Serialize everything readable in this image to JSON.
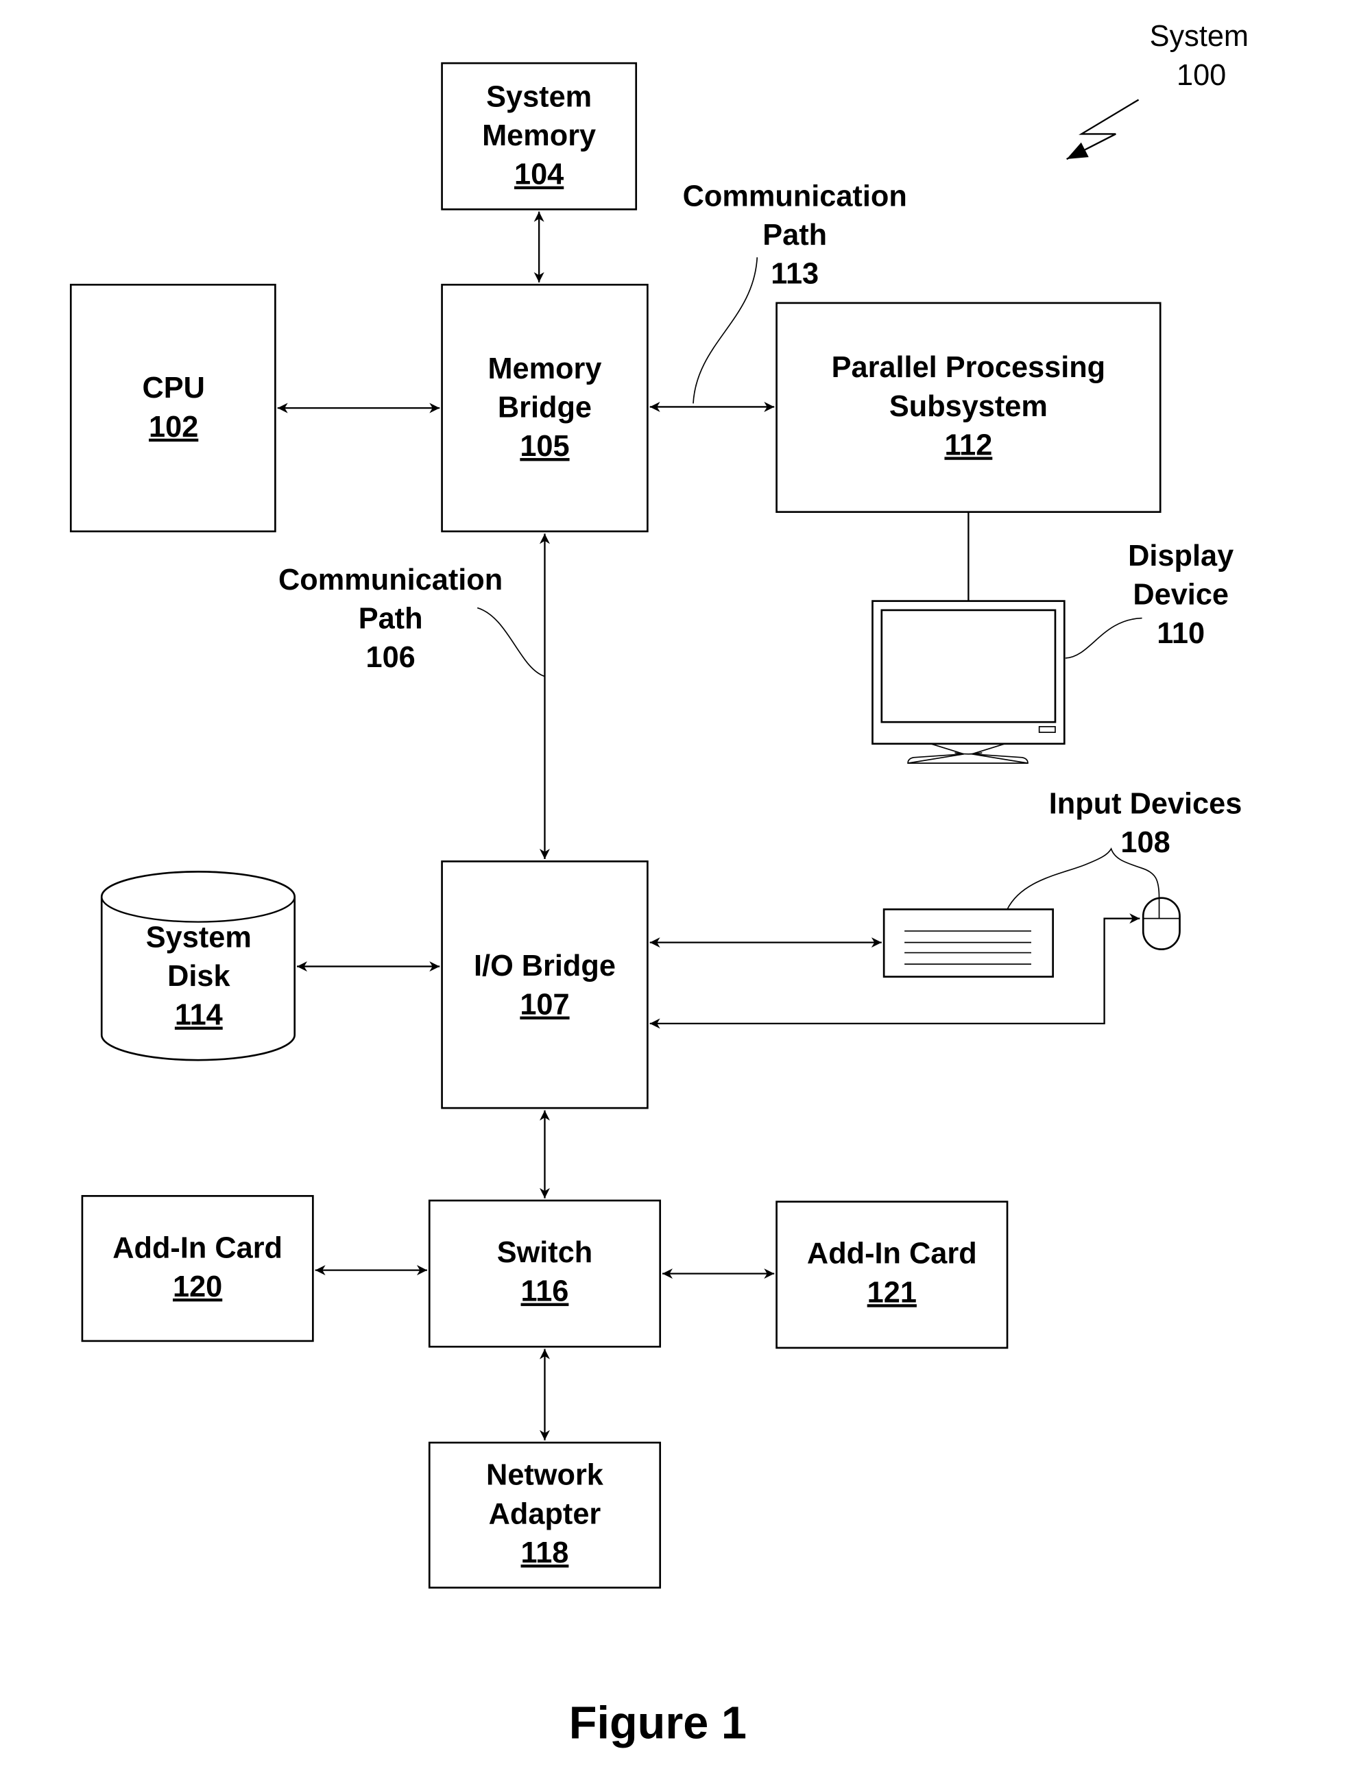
{
  "figure": {
    "caption": "Figure 1",
    "system_label": {
      "name": "System",
      "ref": "100"
    }
  },
  "blocks": {
    "system_memory": {
      "lines": [
        "System",
        "Memory"
      ],
      "ref": "104"
    },
    "cpu": {
      "lines": [
        "CPU"
      ],
      "ref": "102"
    },
    "memory_bridge": {
      "lines": [
        "Memory",
        "Bridge"
      ],
      "ref": "105"
    },
    "parallel_processing": {
      "lines": [
        "Parallel Processing",
        "Subsystem"
      ],
      "ref": "112"
    },
    "io_bridge": {
      "lines": [
        "I/O Bridge"
      ],
      "ref": "107"
    },
    "system_disk": {
      "lines": [
        "System",
        "Disk"
      ],
      "ref": "114"
    },
    "switch": {
      "lines": [
        "Switch"
      ],
      "ref": "116"
    },
    "add_in_card_120": {
      "lines": [
        "Add-In Card"
      ],
      "ref": "120"
    },
    "add_in_card_121": {
      "lines": [
        "Add-In Card"
      ],
      "ref": "121"
    },
    "network_adapter": {
      "lines": [
        "Network",
        "Adapter"
      ],
      "ref": "118"
    }
  },
  "callouts": {
    "comm_path_113": {
      "lines": [
        "Communication",
        "Path"
      ],
      "ref": "113"
    },
    "comm_path_106": {
      "lines": [
        "Communication",
        "Path"
      ],
      "ref": "106"
    },
    "display_device": {
      "lines": [
        "Display",
        "Device"
      ],
      "ref": "110"
    },
    "input_devices": {
      "lines": [
        "Input Devices"
      ],
      "ref": "108"
    }
  },
  "connections": [
    {
      "from": "cpu",
      "to": "memory_bridge",
      "type": "bidirectional"
    },
    {
      "from": "system_memory",
      "to": "memory_bridge",
      "type": "bidirectional"
    },
    {
      "from": "memory_bridge",
      "to": "parallel_processing",
      "type": "bidirectional",
      "label": "comm_path_113"
    },
    {
      "from": "memory_bridge",
      "to": "io_bridge",
      "type": "bidirectional",
      "label": "comm_path_106"
    },
    {
      "from": "parallel_processing",
      "to": "display_device",
      "type": "line"
    },
    {
      "from": "system_disk",
      "to": "io_bridge",
      "type": "bidirectional"
    },
    {
      "from": "io_bridge",
      "to": "keyboard",
      "type": "bidirectional"
    },
    {
      "from": "mouse",
      "to": "io_bridge",
      "type": "unidirectional"
    },
    {
      "from": "io_bridge",
      "to": "switch",
      "type": "bidirectional"
    },
    {
      "from": "add_in_card_120",
      "to": "switch",
      "type": "bidirectional"
    },
    {
      "from": "switch",
      "to": "add_in_card_121",
      "type": "bidirectional"
    },
    {
      "from": "switch",
      "to": "network_adapter",
      "type": "bidirectional"
    }
  ]
}
